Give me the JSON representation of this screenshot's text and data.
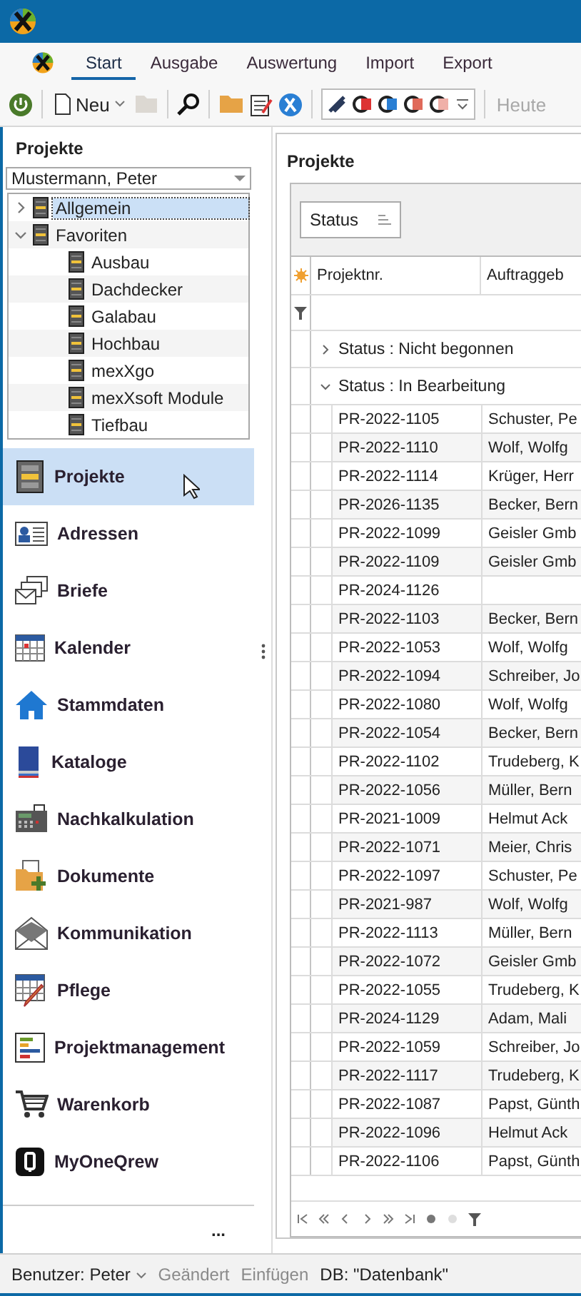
{
  "ribbon": {
    "tabs": [
      {
        "label": "Start",
        "selected": true
      },
      {
        "label": "Ausgabe",
        "selected": false
      },
      {
        "label": "Auswertung",
        "selected": false
      },
      {
        "label": "Import",
        "selected": false
      },
      {
        "label": "Export",
        "selected": false
      }
    ]
  },
  "toolbar": {
    "new_button": {
      "label": "Neu"
    },
    "today_button": {
      "label": "Heute",
      "disabled": true
    }
  },
  "sidebar": {
    "title": "Projekte",
    "user_select": {
      "value": "Mustermann, Peter"
    },
    "tree": [
      {
        "label": "Allgemein",
        "selected": true,
        "expanded": false
      },
      {
        "label": "Favoriten",
        "selected": false,
        "expanded": true,
        "children": [
          {
            "label": "Ausbau",
            "selected": false
          },
          {
            "label": "Dachdecker",
            "selected": false
          },
          {
            "label": "Galabau",
            "selected": false
          },
          {
            "label": "Hochbau",
            "selected": false
          },
          {
            "label": "mexXgo",
            "selected": false
          },
          {
            "label": "mexXsoft Module",
            "selected": false
          },
          {
            "label": "Tiefbau",
            "selected": false
          }
        ]
      }
    ],
    "nav": [
      {
        "label": "Projekte",
        "selected": true
      },
      {
        "label": "Adressen",
        "selected": false
      },
      {
        "label": "Briefe",
        "selected": false
      },
      {
        "label": "Kalender",
        "selected": false
      },
      {
        "label": "Stammdaten",
        "selected": false
      },
      {
        "label": "Kataloge",
        "selected": false
      },
      {
        "label": "Nachkalkulation",
        "selected": false
      },
      {
        "label": "Dokumente",
        "selected": false
      },
      {
        "label": "Kommunikation",
        "selected": false
      },
      {
        "label": "Pflege",
        "selected": false
      },
      {
        "label": "Projektmanagement",
        "selected": false
      },
      {
        "label": "Warenkorb",
        "selected": false
      },
      {
        "label": "MyOneQrew",
        "selected": false
      }
    ],
    "more_label": "..."
  },
  "grid": {
    "title": "Projekte",
    "group_panel": [
      {
        "label": "Status"
      }
    ],
    "columns": [
      "Projektnr.",
      "Auftraggeb"
    ],
    "groups": [
      {
        "label": "Status : Nicht begonnen",
        "expanded": false
      },
      {
        "label": "Status : In Bearbeitung",
        "expanded": true,
        "rows": [
          {
            "number": "PR-2022-1105",
            "client": "Schuster, Pe"
          },
          {
            "number": "PR-2022-1110",
            "client": "Wolf, Wolfg"
          },
          {
            "number": "PR-2022-1114",
            "client": "Krüger, Herr"
          },
          {
            "number": "PR-2026-1135",
            "client": "Becker, Bern"
          },
          {
            "number": "PR-2022-1099",
            "client": "Geisler Gmb"
          },
          {
            "number": "PR-2022-1109",
            "client": "Geisler Gmb"
          },
          {
            "number": "PR-2024-1126"
          },
          {
            "number": "PR-2022-1103",
            "client": "Becker, Bern"
          },
          {
            "number": "PR-2022-1053",
            "client": "Wolf, Wolfg"
          },
          {
            "number": "PR-2022-1094",
            "client": "Schreiber, Jo"
          },
          {
            "number": "PR-2022-1080",
            "client": "Wolf, Wolfg"
          },
          {
            "number": "PR-2022-1054",
            "client": "Becker, Bern"
          },
          {
            "number": "PR-2022-1102",
            "client": "Trudeberg, K"
          },
          {
            "number": "PR-2022-1056",
            "client": "Müller, Bern"
          },
          {
            "number": "PR-2021-1009",
            "client": "Helmut Ack"
          },
          {
            "number": "PR-2022-1071",
            "client": "Meier, Chris"
          },
          {
            "number": "PR-2022-1097",
            "client": "Schuster, Pe"
          },
          {
            "number": "PR-2021-987",
            "client": "Wolf, Wolfg"
          },
          {
            "number": "PR-2022-1113",
            "client": "Müller, Bern"
          },
          {
            "number": "PR-2022-1072",
            "client": "Geisler Gmb"
          },
          {
            "number": "PR-2022-1055",
            "client": "Trudeberg, K"
          },
          {
            "number": "PR-2024-1129",
            "client": "Adam, Mali"
          },
          {
            "number": "PR-2022-1059",
            "client": "Schreiber, Jo"
          },
          {
            "number": "PR-2022-1117",
            "client": "Trudeberg, K"
          },
          {
            "number": "PR-2022-1087",
            "client": "Papst, Günth"
          },
          {
            "number": "PR-2022-1096",
            "client": "Helmut Ack"
          },
          {
            "number": "PR-2022-1106",
            "client": "Papst, Günth"
          }
        ]
      }
    ]
  },
  "status_bar": {
    "user": "Benutzer: Peter",
    "items": [
      {
        "label": "Geändert",
        "disabled": true
      },
      {
        "label": "Einfügen",
        "disabled": true
      },
      {
        "label": "DB: \"Datenbank\"",
        "disabled": false
      }
    ]
  }
}
